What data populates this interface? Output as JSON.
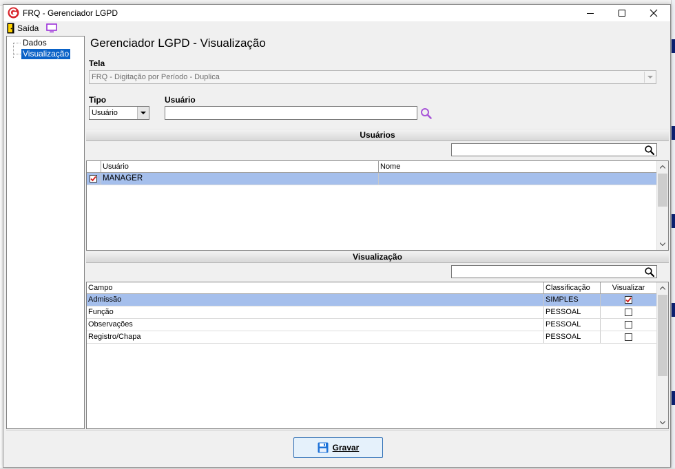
{
  "window": {
    "title": "FRQ - Gerenciador LGPD"
  },
  "toolbar": {
    "exit_label": "Saída"
  },
  "tree": {
    "items": [
      "Dados",
      "Visualização"
    ],
    "selected": 1
  },
  "page_title": "Gerenciador LGPD - Visualização",
  "form": {
    "tela_label": "Tela",
    "tela_value": "FRQ - Digitação por Período - Duplica",
    "tipo_label": "Tipo",
    "tipo_value": "Usuário",
    "usuario_label": "Usuário",
    "usuario_value": ""
  },
  "users_section": {
    "header": "Usuários",
    "search_value": "",
    "columns": [
      "Usuário",
      "Nome"
    ],
    "rows": [
      {
        "usuario": "MANAGER",
        "nome": "",
        "checked": true,
        "selected": true
      }
    ]
  },
  "visual_section": {
    "header": "Visualização",
    "search_value": "",
    "columns": [
      "Campo",
      "Classificação",
      "Visualizar"
    ],
    "rows": [
      {
        "campo": "Admissão",
        "classificacao": "SIMPLES",
        "visualizar": true,
        "selected": true
      },
      {
        "campo": "Função",
        "classificacao": "PESSOAL",
        "visualizar": false,
        "selected": false
      },
      {
        "campo": "Observações",
        "classificacao": "PESSOAL",
        "visualizar": false,
        "selected": false
      },
      {
        "campo": "Registro/Chapa",
        "classificacao": "PESSOAL",
        "visualizar": false,
        "selected": false
      }
    ]
  },
  "footer": {
    "save_label": "Gravar"
  },
  "colors": {
    "selection": "#a5bfec",
    "tree_selection": "#0a62c7",
    "checkmark": "#d11919",
    "accent_purple": "#9b30d9"
  }
}
